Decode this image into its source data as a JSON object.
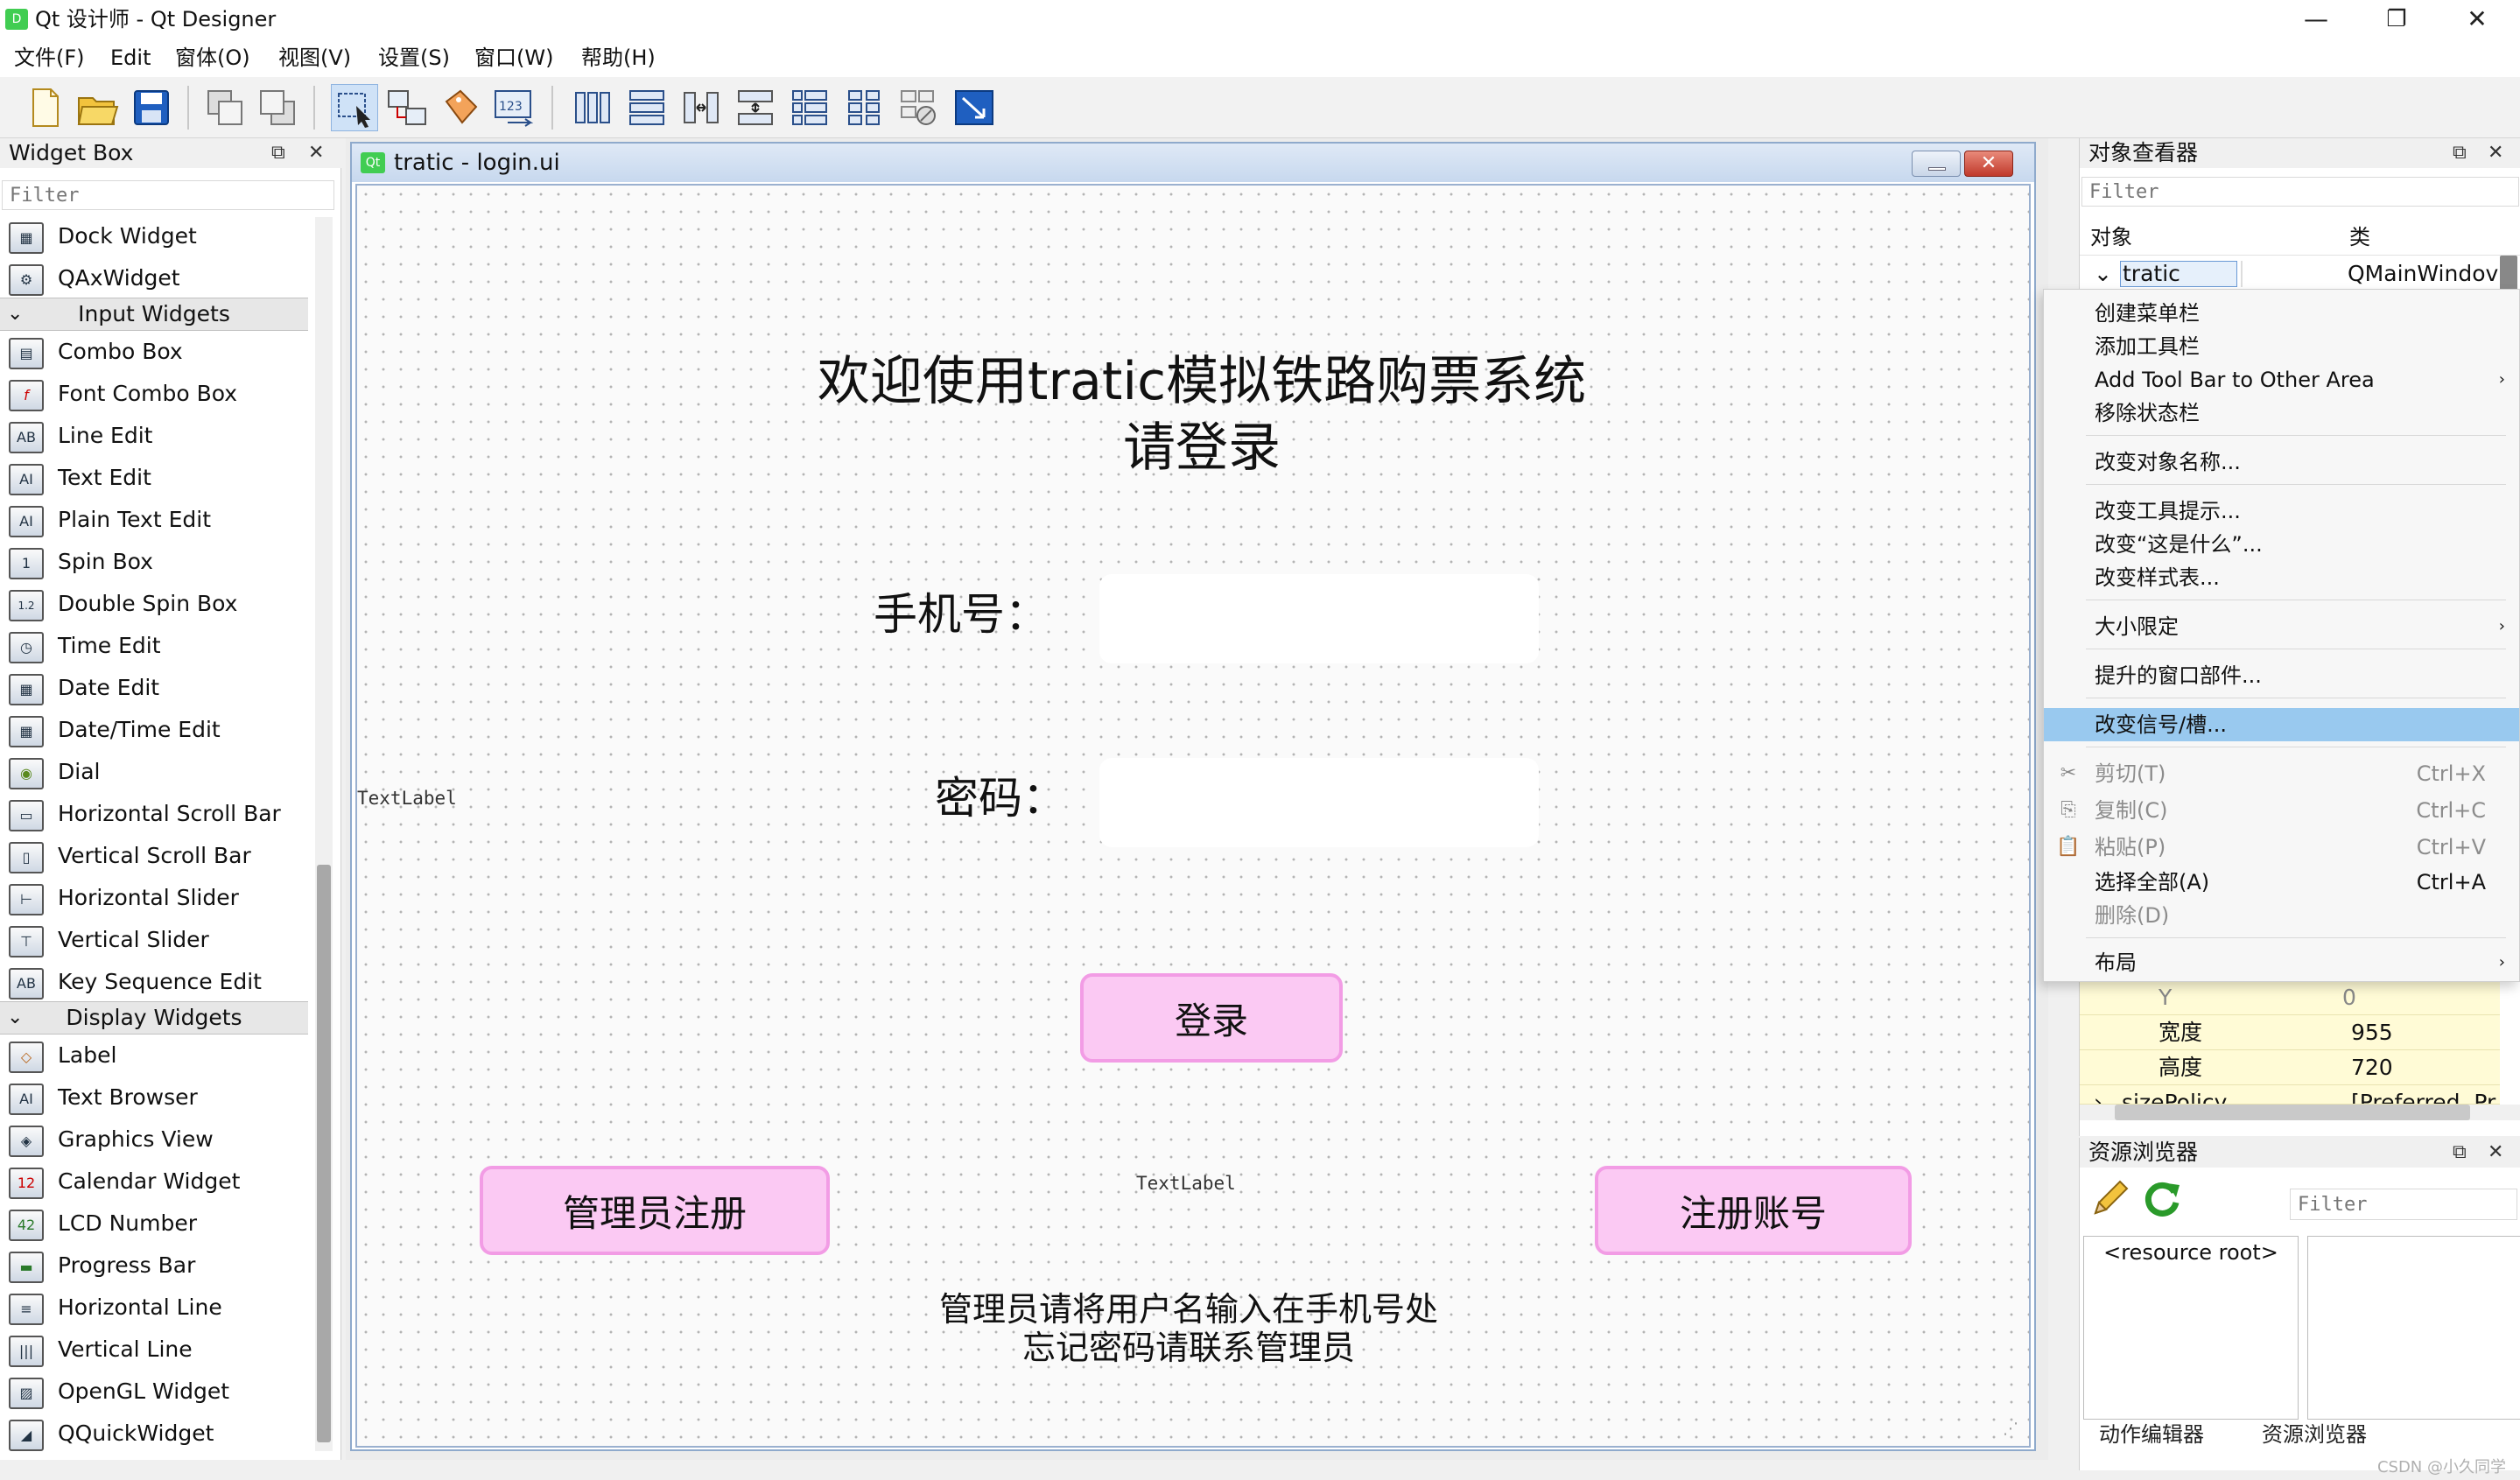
{
  "window": {
    "title": "Qt 设计师 - Qt Designer",
    "minimize": "—",
    "restore": "❐",
    "close": "✕"
  },
  "menubar": {
    "items": [
      "文件(F)",
      "Edit",
      "窗体(O)",
      "视图(V)",
      "设置(S)",
      "窗口(W)",
      "帮助(H)"
    ]
  },
  "widget_box": {
    "title": "Widget Box",
    "float": "⧉",
    "close": "✕",
    "filter_placeholder": "Filter",
    "items_top": [
      {
        "label": "Dock Widget",
        "icon": "▦"
      },
      {
        "label": "QAxWidget",
        "icon": "⚙"
      }
    ],
    "input_category": "Input Widgets",
    "input_items": [
      {
        "label": "Combo Box",
        "icon": "▤"
      },
      {
        "label": "Font Combo Box",
        "icon": "f"
      },
      {
        "label": "Line Edit",
        "icon": "AB"
      },
      {
        "label": "Text Edit",
        "icon": "AI"
      },
      {
        "label": "Plain Text Edit",
        "icon": "AI"
      },
      {
        "label": "Spin Box",
        "icon": "1"
      },
      {
        "label": "Double Spin Box",
        "icon": "1.2"
      },
      {
        "label": "Time Edit",
        "icon": "◷"
      },
      {
        "label": "Date Edit",
        "icon": "▦"
      },
      {
        "label": "Date/Time Edit",
        "icon": "▦"
      },
      {
        "label": "Dial",
        "icon": "◉"
      },
      {
        "label": "Horizontal Scroll Bar",
        "icon": "▭"
      },
      {
        "label": "Vertical Scroll Bar",
        "icon": "▯"
      },
      {
        "label": "Horizontal Slider",
        "icon": "⊢"
      },
      {
        "label": "Vertical Slider",
        "icon": "⊤"
      },
      {
        "label": "Key Sequence Edit",
        "icon": "AB"
      }
    ],
    "display_category": "Display Widgets",
    "display_items": [
      {
        "label": "Label",
        "icon": "◇"
      },
      {
        "label": "Text Browser",
        "icon": "AI"
      },
      {
        "label": "Graphics View",
        "icon": "◈"
      },
      {
        "label": "Calendar Widget",
        "icon": "12"
      },
      {
        "label": "LCD Number",
        "icon": "42"
      },
      {
        "label": "Progress Bar",
        "icon": "▬"
      },
      {
        "label": "Horizontal Line",
        "icon": "≡"
      },
      {
        "label": "Vertical Line",
        "icon": "|||"
      },
      {
        "label": "OpenGL Widget",
        "icon": "▨"
      },
      {
        "label": "QQuickWidget",
        "icon": "◢"
      }
    ]
  },
  "form": {
    "window_title": "tratic - login.ui",
    "qt_badge": "Qt",
    "heading_line1": "欢迎使用tratic模拟铁路购票系统",
    "heading_line2": "请登录",
    "phone_label": "手机号：",
    "password_label": "密码：",
    "login_button": "登录",
    "admin_register_button": "管理员注册",
    "register_button": "注册账号",
    "textlabel_left": "TextLabel",
    "textlabel_center": "TextLabel",
    "note_line1": "管理员请将用户名输入在手机号处",
    "note_line2": "忘记密码请联系管理员"
  },
  "object_inspector": {
    "title": "对象查看器",
    "float": "⧉",
    "close": "✕",
    "filter_placeholder": "Filter",
    "col_object": "对象",
    "col_class": "类",
    "root_object": "tratic",
    "root_class": "QMainWindov",
    "expand_arrow": "⌄"
  },
  "properties": [
    {
      "name": "Y",
      "value": "0"
    },
    {
      "name": "宽度",
      "value": "955"
    },
    {
      "name": "高度",
      "value": "720"
    },
    {
      "name": "sizePolicy",
      "value": "[Preferred, Pr"
    }
  ],
  "context_menu": {
    "items": [
      {
        "label": "创建菜单栏"
      },
      {
        "label": "添加工具栏"
      },
      {
        "label": "Add Tool Bar to Other Area",
        "arrow": "›"
      },
      {
        "label": "移除状态栏"
      },
      {
        "label": "改变对象名称..."
      },
      {
        "label": "改变工具提示..."
      },
      {
        "label": "改变“这是什么”..."
      },
      {
        "label": "改变样式表..."
      },
      {
        "label": "大小限定",
        "arrow": "›"
      },
      {
        "label": "提升的窗口部件..."
      },
      {
        "label": "改变信号/槽..."
      },
      {
        "label": "剪切(T)",
        "shortcut": "Ctrl+X"
      },
      {
        "label": "复制(C)",
        "shortcut": "Ctrl+C"
      },
      {
        "label": "粘贴(P)",
        "shortcut": "Ctrl+V"
      },
      {
        "label": "选择全部(A)",
        "shortcut": "Ctrl+A"
      },
      {
        "label": "删除(D)"
      },
      {
        "label": "布局",
        "arrow": "›"
      }
    ]
  },
  "resource_browser": {
    "title": "资源浏览器",
    "float": "⧉",
    "close": "✕",
    "filter_placeholder": "Filter",
    "root": "<resource root>",
    "tab_action_editor": "动作编辑器",
    "tab_resource_browser": "资源浏览器"
  },
  "watermark": "CSDN @小久同学",
  "colors": {
    "button_fill": "#fbc9f3",
    "button_border": "#f29ce5",
    "menu_highlight": "#99c9ef",
    "property_row": "#fffbd6",
    "qt_green": "#41cd52"
  }
}
